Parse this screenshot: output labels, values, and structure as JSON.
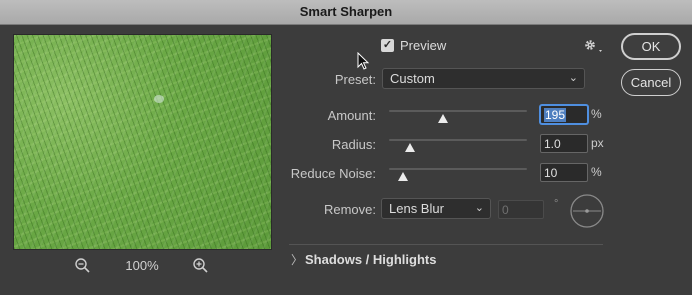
{
  "window": {
    "title": "Smart Sharpen"
  },
  "preview": {
    "zoom_level": "100%"
  },
  "options": {
    "preview_checked": true,
    "preview_label": "Preview",
    "preset_label": "Preset:",
    "preset_value": "Custom",
    "amount_label": "Amount:",
    "amount_value": "195",
    "amount_unit": "%",
    "amount_slider_fraction": 0.39,
    "radius_label": "Radius:",
    "radius_value": "1.0",
    "radius_unit": "px",
    "radius_slider_fraction": 0.15,
    "noise_label": "Reduce Noise:",
    "noise_value": "10",
    "noise_unit": "%",
    "noise_slider_fraction": 0.1,
    "remove_label": "Remove:",
    "remove_value": "Lens Blur",
    "angle_value": "0",
    "angle_unit": "°"
  },
  "buttons": {
    "ok_label": "OK",
    "cancel_label": "Cancel"
  },
  "sections": {
    "shadows_highlights_label": "Shadows / Highlights"
  },
  "icons": {
    "zoom_out": "zoom-out-icon",
    "zoom_in": "zoom-in-icon",
    "gear": "gear-icon",
    "checkmark": "checkmark-icon",
    "chevron_down": "chevron-down-icon",
    "chevron_right": "chevron-right-icon",
    "angle_dial": "angle-dial-icon",
    "cursor": "arrow-cursor-icon"
  },
  "colors": {
    "title_bar": "#b3b3b3",
    "dialog_bg": "#3c3c3c",
    "focus_ring": "#4f8fe0"
  }
}
